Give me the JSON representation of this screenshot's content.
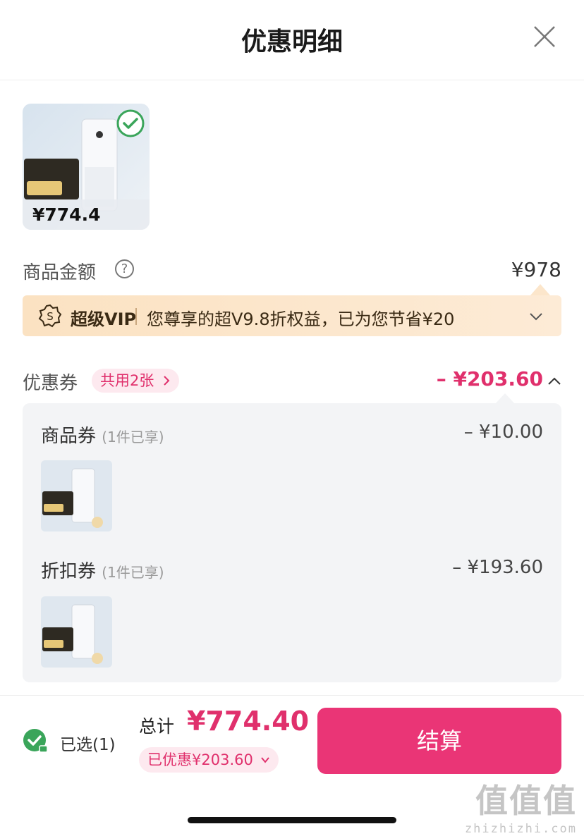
{
  "header": {
    "title": "优惠明细"
  },
  "product": {
    "thumb_price": "¥774.4"
  },
  "amount": {
    "label": "商品金额",
    "help": "?",
    "value": "¥978"
  },
  "vip": {
    "name": "超级VIP",
    "text": "您尊享的超V9.8折权益，已为您节省¥20"
  },
  "coupons": {
    "label": "优惠券",
    "count": "共用2张",
    "total": "– ¥203.60",
    "items": [
      {
        "name": "商品券",
        "note": "(1件已享)",
        "value": "– ¥10.00"
      },
      {
        "name": "折扣券",
        "note": "(1件已享)",
        "value": "– ¥193.60"
      }
    ]
  },
  "footer": {
    "selected": "已选(1)",
    "total_label": "总计",
    "total_value": "¥774.40",
    "saved": "已优惠¥203.60",
    "checkout": "结算"
  },
  "watermark": {
    "glyphs": "值值值",
    "url": "zhizhizhi.com"
  },
  "colors": {
    "accent": "#e0306c",
    "button": "#ea3576",
    "vip_bg": "#fbe2c2",
    "panel_bg": "#f3f4f6",
    "check": "#3aa55a"
  }
}
